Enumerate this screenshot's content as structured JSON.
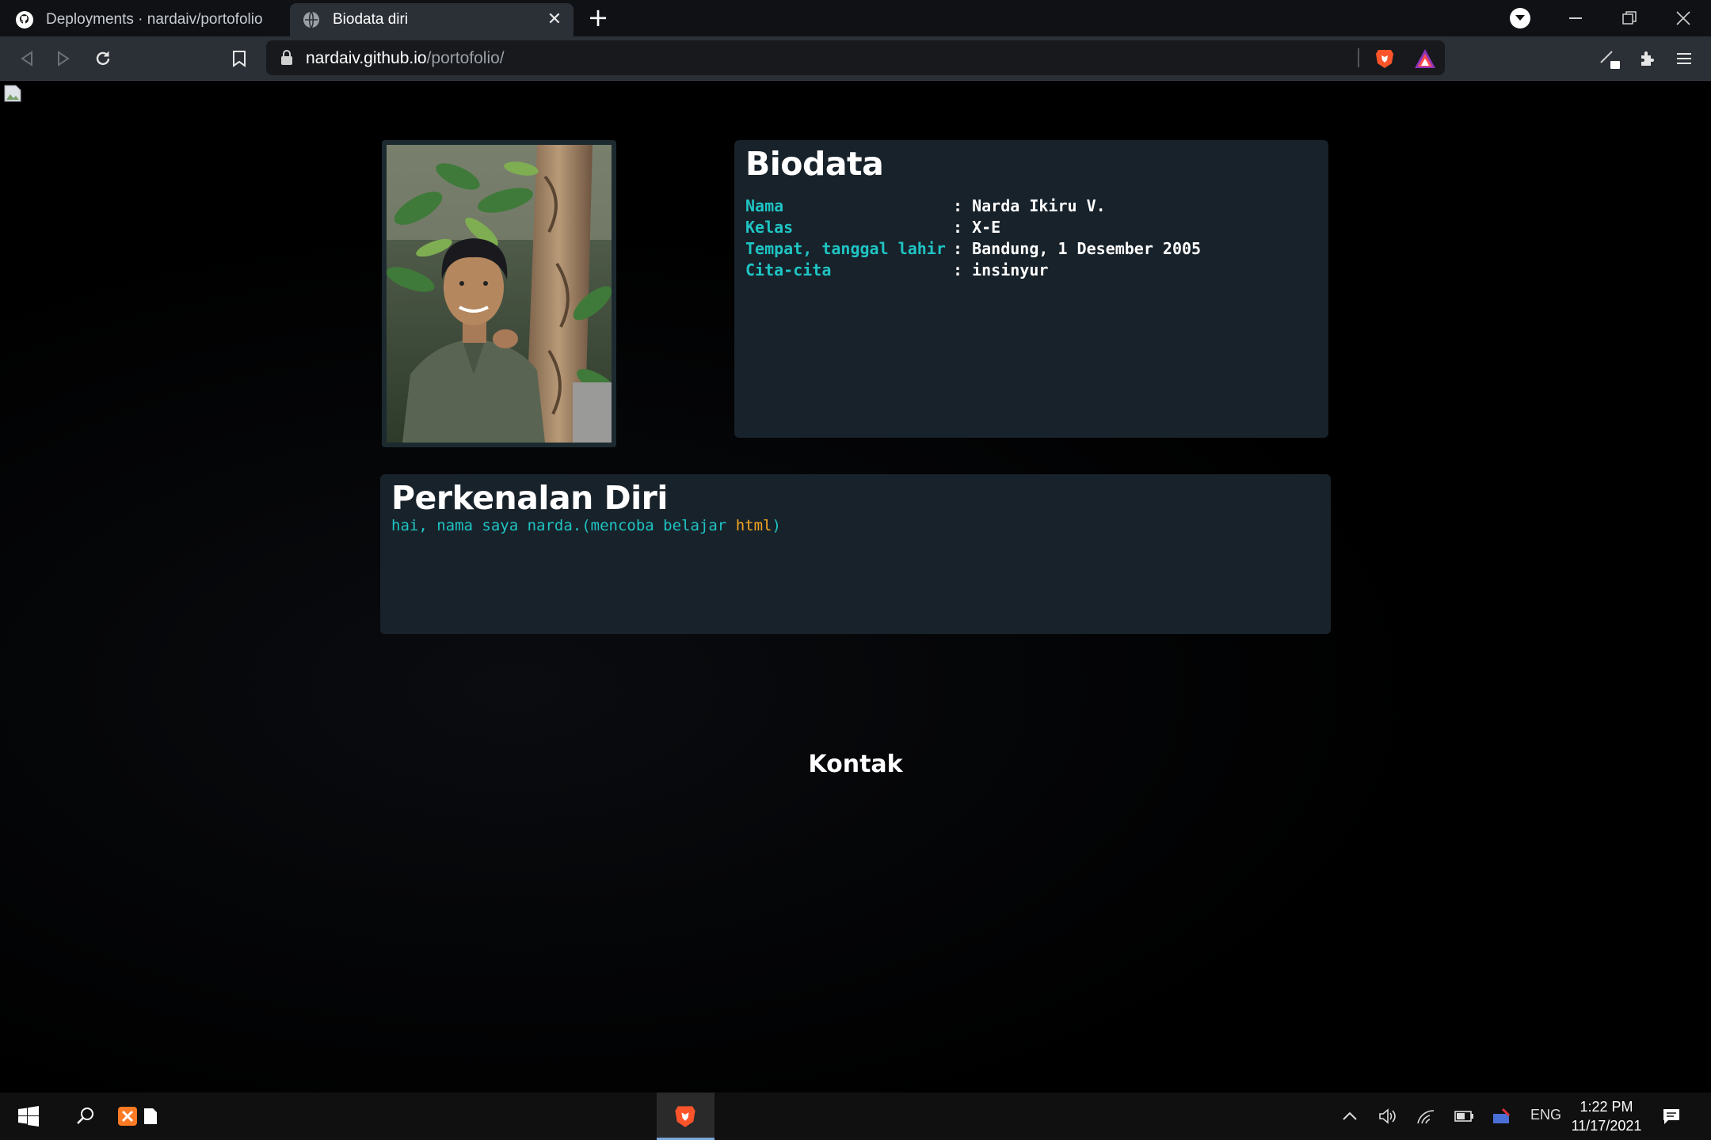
{
  "browser": {
    "tabs": [
      {
        "title": "Deployments · nardaiv/portofolio",
        "active": false,
        "icon": "github-icon"
      },
      {
        "title": "Biodata diri",
        "active": true,
        "icon": "globe-icon"
      }
    ],
    "url_host": "nardaiv.github.io",
    "url_path": "/portofolio/"
  },
  "page": {
    "biodata": {
      "title": "Biodata",
      "rows": [
        {
          "key": "Nama",
          "value": ": Narda Ikiru V."
        },
        {
          "key": "Kelas",
          "value": ": X-E"
        },
        {
          "key": "Tempat, tanggal lahir",
          "value": ": Bandung, 1 Desember 2005"
        },
        {
          "key": "Cita-cita",
          "value": ": insinyur"
        }
      ]
    },
    "intro": {
      "title": "Perkenalan Diri",
      "text_before": "hai, nama saya narda.(mencoba belajar ",
      "text_highlight": "html",
      "text_after": ")"
    },
    "contact_heading": "Kontak"
  },
  "taskbar": {
    "lang": "ENG",
    "time": "1:22 PM",
    "date": "11/17/2021"
  },
  "colors": {
    "accent_cyan": "#1fc4c4",
    "accent_orange": "#f5a623",
    "card_bg": "#18222a"
  }
}
